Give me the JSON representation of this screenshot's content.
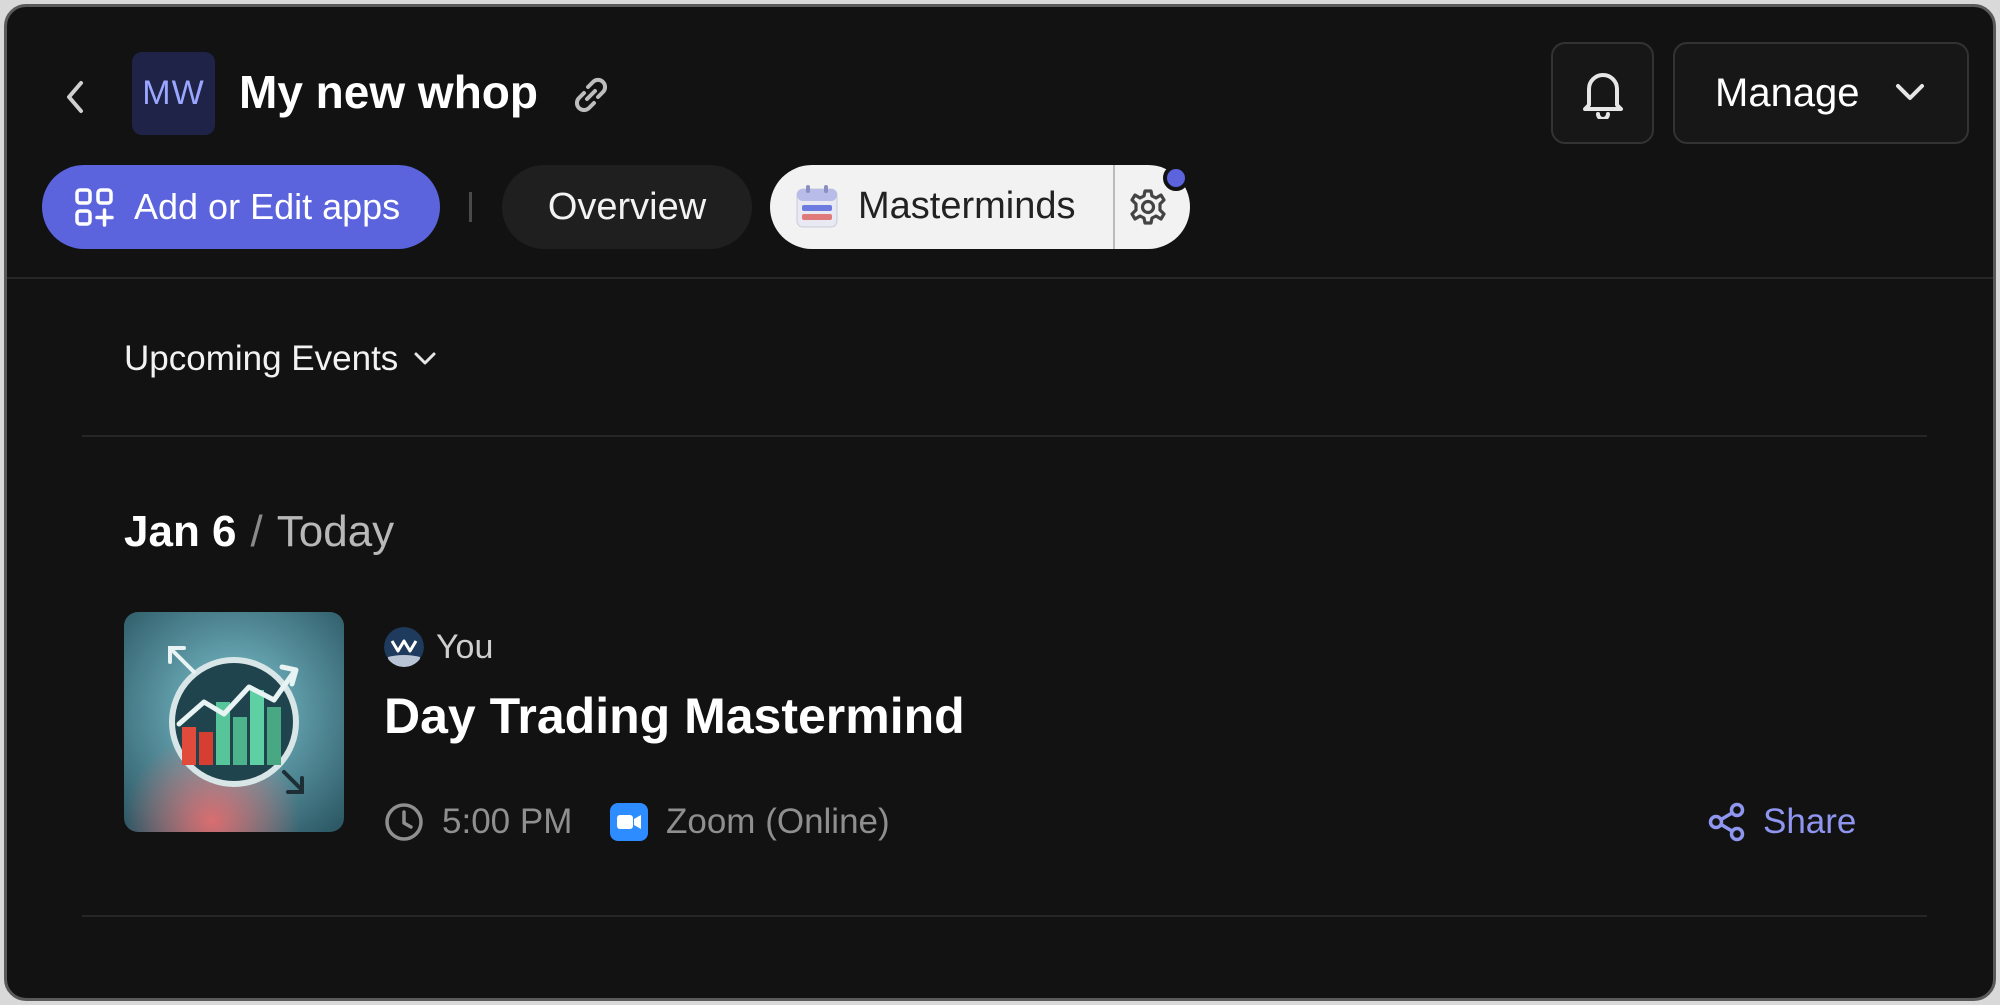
{
  "header": {
    "avatar_initials": "MW",
    "title": "My new whop",
    "manage_label": "Manage"
  },
  "tabs": {
    "add_apps_label": "Add or Edit apps",
    "overview_label": "Overview",
    "masterminds_label": "Masterminds"
  },
  "filter": {
    "label": "Upcoming Events"
  },
  "event_group": {
    "date": "Jan 6",
    "relative": "Today"
  },
  "event": {
    "host": "You",
    "title": "Day Trading Mastermind",
    "time": "5:00 PM",
    "location": "Zoom (Online)",
    "share_label": "Share"
  },
  "colors": {
    "accent": "#5b63dd",
    "background": "#121212",
    "share_link": "#8f96f0"
  }
}
